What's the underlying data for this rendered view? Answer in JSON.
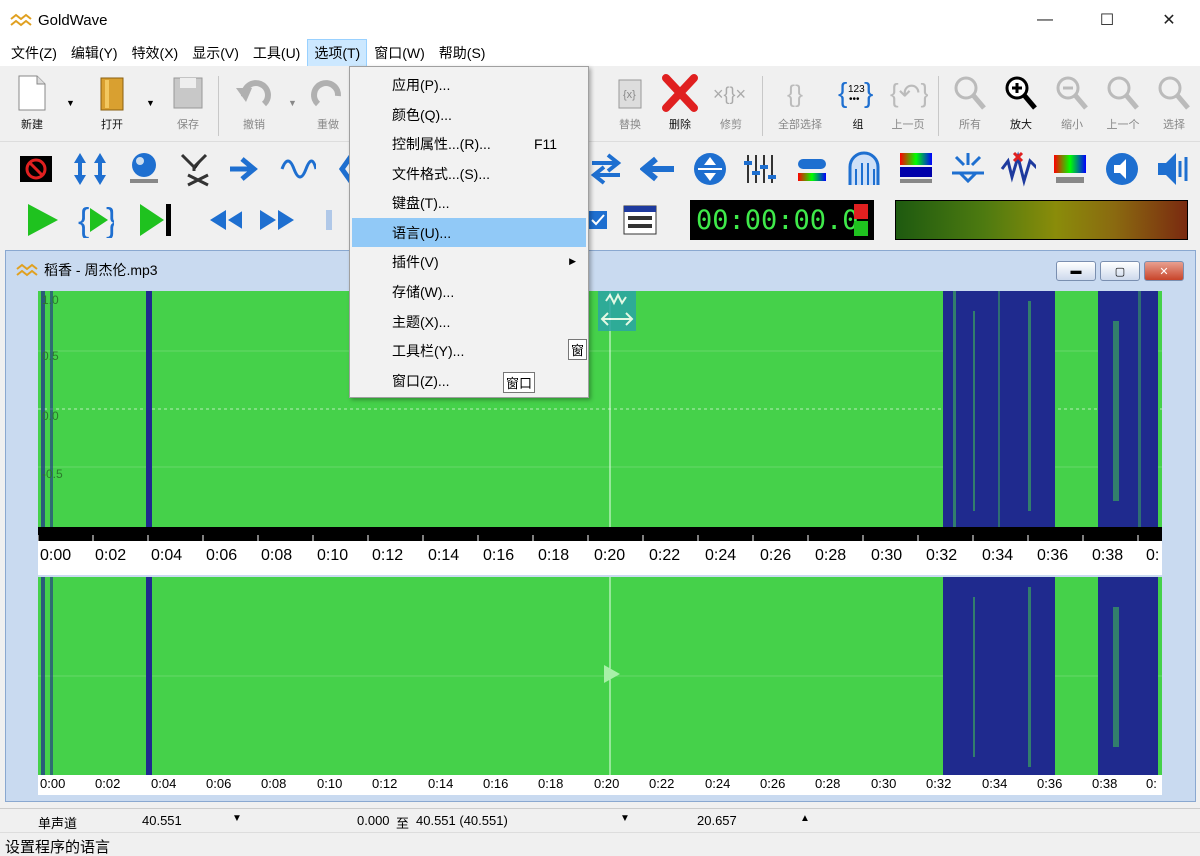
{
  "window": {
    "title": "GoldWave",
    "minimize": "—",
    "maximize": "☐",
    "close": "✕"
  },
  "menu": [
    "文件(Z)",
    "编辑(Y)",
    "特效(X)",
    "显示(V)",
    "工具(U)",
    "选项(T)",
    "窗口(W)",
    "帮助(S)"
  ],
  "toolbar": {
    "new": "新建",
    "open": "打开",
    "save": "保存",
    "undo": "撤销",
    "redo": "重做",
    "replace": "替换",
    "delete": "删除",
    "trim": "修剪",
    "select_all": "全部选择",
    "group": "组",
    "prev_page": "上一页",
    "all": "所有",
    "zoom_in": "放大",
    "zoom_out": "缩小",
    "prev": "上一个",
    "select": "选择"
  },
  "timer": "00:00:00.0",
  "options_menu": {
    "items": [
      {
        "label": "应用(P)..."
      },
      {
        "label": "颜色(Q)..."
      },
      {
        "label": "控制属性...(R)...",
        "shortcut": "F11"
      },
      {
        "label": "文件格式...(S)..."
      },
      {
        "label": "键盘(T)..."
      },
      {
        "label": "语言(U)..."
      },
      {
        "label": "插件(V)"
      },
      {
        "label": "存储(W)..."
      },
      {
        "label": "主题(X)..."
      },
      {
        "label": "工具栏(Y)..."
      },
      {
        "label": "窗口(Z)..."
      }
    ],
    "tip1": "窗",
    "tip2": "窗口"
  },
  "document": {
    "title": "稻香 - 周杰伦.mp3",
    "axis": [
      "1.0",
      "0.5",
      "0.0",
      "-0.5"
    ],
    "time_ticks": [
      "0:00",
      "0:02",
      "0:04",
      "0:06",
      "0:08",
      "0:10",
      "0:12",
      "0:14",
      "0:16",
      "0:18",
      "0:20",
      "0:22",
      "0:24",
      "0:26",
      "0:28",
      "0:30",
      "0:32",
      "0:34",
      "0:36",
      "0:38",
      "0:"
    ]
  },
  "status": {
    "channel": "单声道",
    "length": "40.551",
    "selection_prefix": "0.000",
    "selection_to": "至",
    "selection_suffix": "40.551 (40.551)",
    "position": "20.657",
    "message": "设置程序的语言"
  },
  "colors": {
    "wave": "#45d14a",
    "wave_dark": "#1f2a8e",
    "timer_text": "#3fe94a",
    "menu_highlight": "#91c9f7"
  }
}
